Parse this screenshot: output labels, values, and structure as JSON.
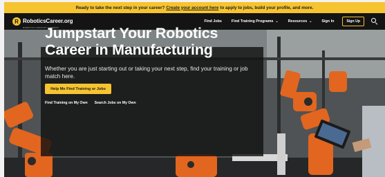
{
  "announcement": {
    "before": "Ready to take the next step in your career?",
    "link": "Create your account here",
    "after": "to apply to jobs, build your profile, and more."
  },
  "nav": {
    "logo_mark": "R",
    "logo_text": "RoboticsCareer.org",
    "logo_tagline": "ROBOTICS INDUSTRY CAREERS",
    "items": {
      "find_jobs": "Find Jobs",
      "find_training": "Find Training Programs",
      "resources": "Resources",
      "sign_in": "Sign In",
      "sign_up": "Sign Up"
    },
    "icons": {
      "dropdown": "chevron-down-icon",
      "search": "search-icon"
    }
  },
  "hero": {
    "headline": "Jumpstart Your Robotics Career in Manufacturing",
    "subtext": "Whether you are just starting out or taking your next step, find your training or job match here.",
    "cta": "Help Me Find Training or Jobs",
    "link_training": "Find Training on My Own",
    "link_jobs": "Search Jobs on My Own"
  },
  "colors": {
    "accent": "#f6c431",
    "nav_bg": "#141414",
    "robot_orange": "#e2661f"
  }
}
